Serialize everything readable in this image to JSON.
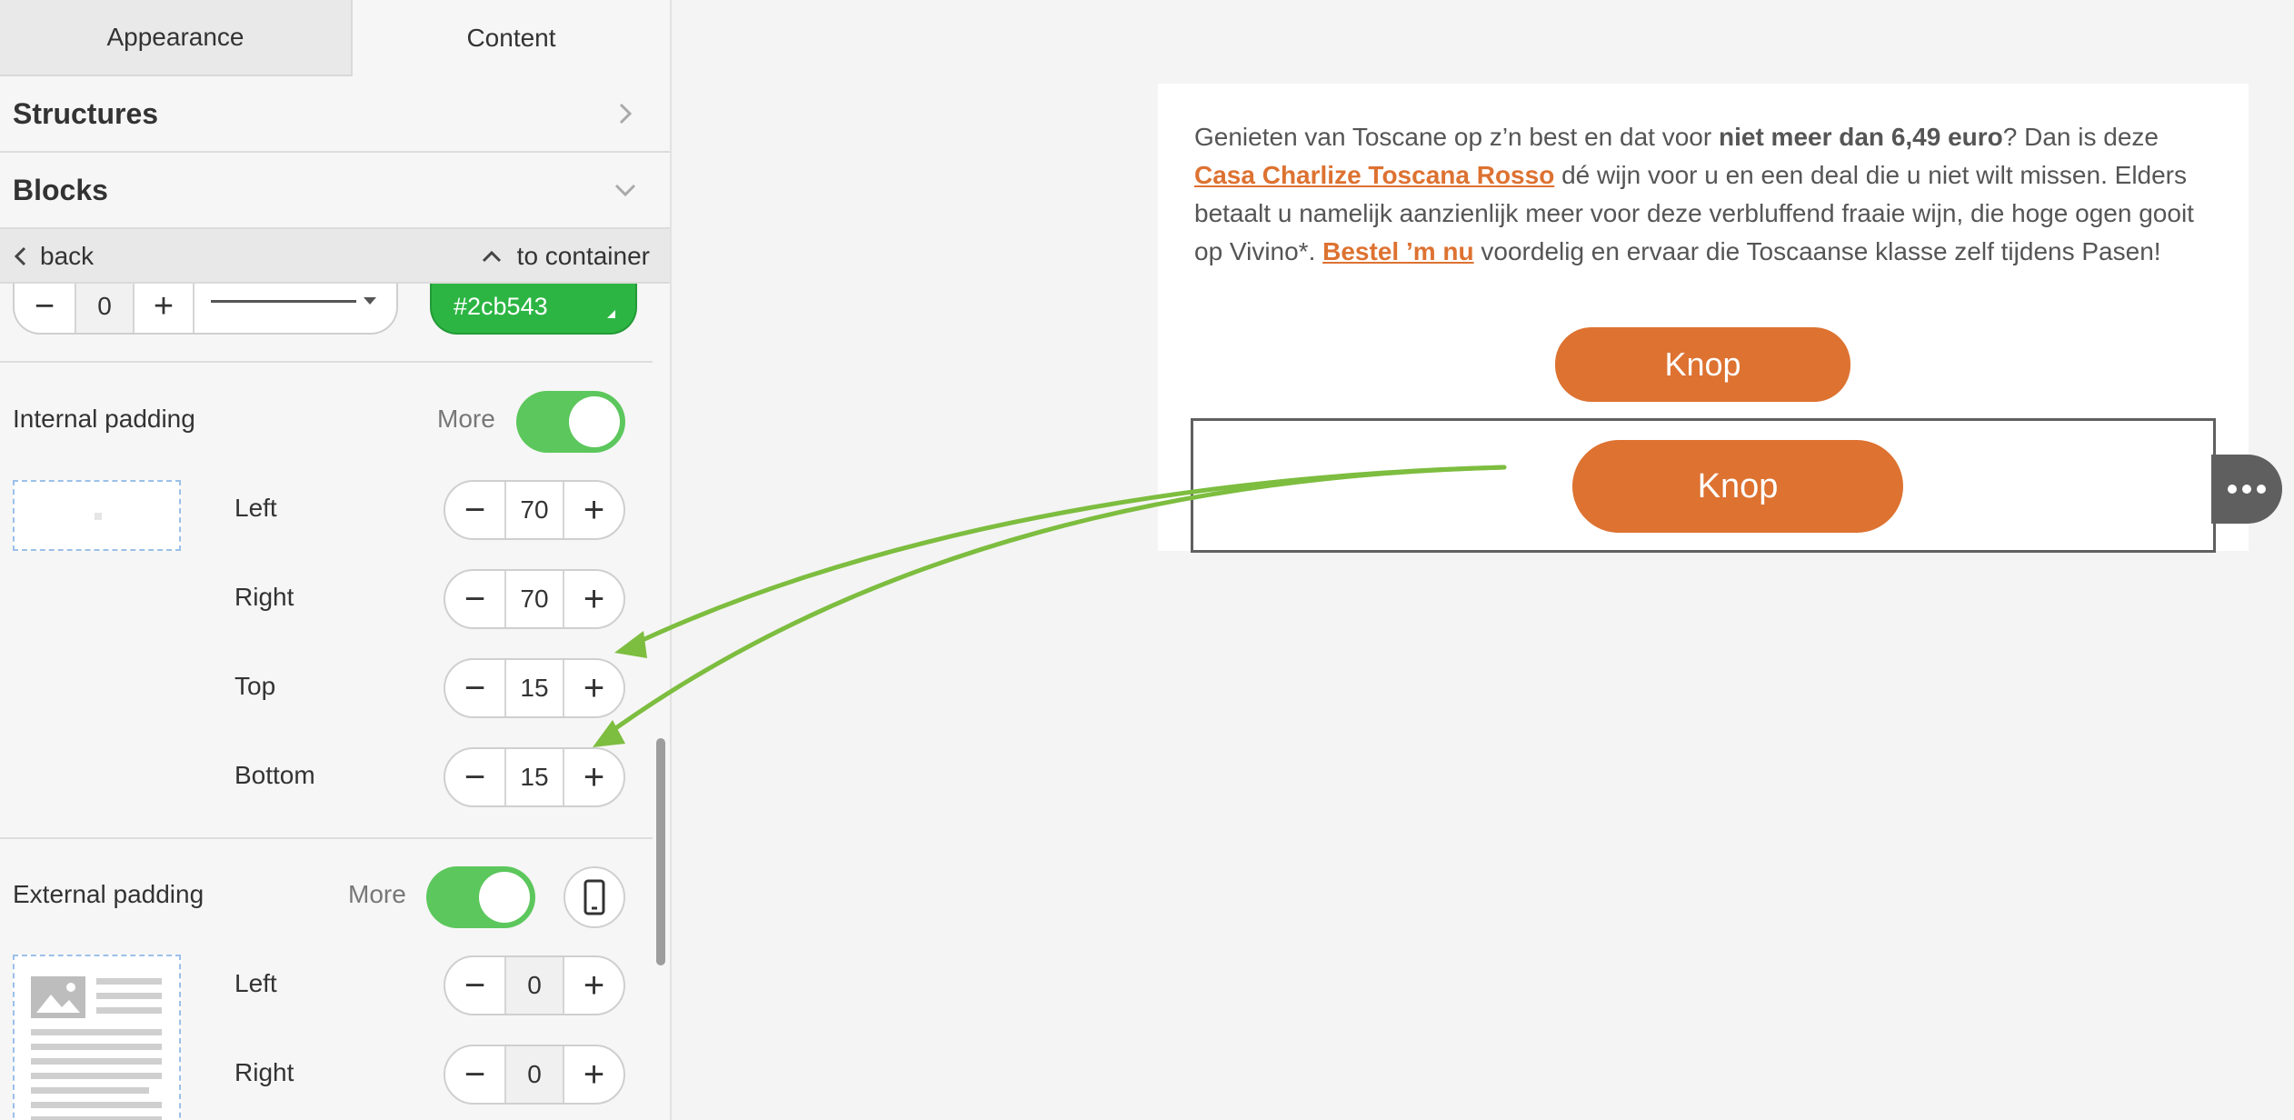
{
  "tabs": {
    "appearance": "Appearance",
    "content": "Content"
  },
  "accordion": {
    "structures": "Structures",
    "blocks": "Blocks"
  },
  "navbar": {
    "back": "back",
    "to_container": "to container"
  },
  "border": {
    "width_value": "0",
    "color_value": "#2cb543"
  },
  "internal_padding": {
    "label": "Internal padding",
    "more_label": "More",
    "more_enabled": true,
    "left": {
      "label": "Left",
      "value": "70"
    },
    "right": {
      "label": "Right",
      "value": "70"
    },
    "top": {
      "label": "Top",
      "value": "15"
    },
    "bottom": {
      "label": "Bottom",
      "value": "15"
    }
  },
  "external_padding": {
    "label": "External padding",
    "more_label": "More",
    "more_enabled": true,
    "left": {
      "label": "Left",
      "value": "0"
    },
    "right": {
      "label": "Right",
      "value": "0"
    }
  },
  "email": {
    "p_intro": "Genieten van Toscane op z’n best en dat voor ",
    "p_bold": "niet meer dan 6,49 euro",
    "p_mid1": "? Dan is deze ",
    "p_link1": "Casa Charlize Toscana Rosso",
    "p_mid2": " dé wijn voor u en een deal die u niet wilt missen. Elders betaalt u namelijk aanzienlijk meer voor deze verbluffend fraaie wijn, die hoge ogen gooit op Vivino*. ",
    "p_link2": "Bestel ’m nu",
    "p_end": " voordelig en ervaar die Toscaanse klasse zelf tijdens Pasen!",
    "button1": "Knop",
    "button2": "Knop"
  },
  "colors": {
    "accent_orange": "#dd7231",
    "toggle_green": "#5cc75c",
    "border_color": "#2cb543",
    "annotation_green": "#7dbd3f"
  }
}
